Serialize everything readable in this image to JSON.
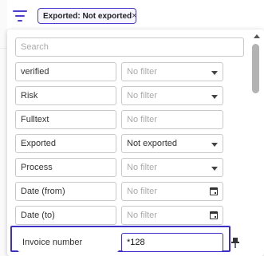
{
  "toolbar": {
    "filter_icon": "filter-lines-icon",
    "chip": {
      "label": "Exported: Not exported",
      "close": "×"
    }
  },
  "popup": {
    "search": {
      "placeholder": "Search"
    },
    "rows": [
      {
        "name": "verified",
        "value": "No filter",
        "control": "select",
        "is_placeholder": true
      },
      {
        "name": "Risk",
        "value": "No filter",
        "control": "select",
        "is_placeholder": true
      },
      {
        "name": "Fulltext",
        "value": "No filter",
        "control": "text",
        "is_placeholder": true
      },
      {
        "name": "Exported",
        "value": "Not exported",
        "control": "select",
        "is_placeholder": false
      },
      {
        "name": "Process",
        "value": "No filter",
        "control": "select",
        "is_placeholder": true
      },
      {
        "name": "Date (from)",
        "value": "No filter",
        "control": "date",
        "is_placeholder": true
      },
      {
        "name": "Date (to)",
        "value": "No filter",
        "control": "date",
        "is_placeholder": true
      },
      {
        "name": "Invoice number",
        "value": "*128",
        "control": "text",
        "is_placeholder": false,
        "focused": true,
        "pin_icon": "pin-icon"
      }
    ]
  },
  "colors": {
    "accent": "#4a3fd1",
    "highlight_border": "#3b2fc9"
  }
}
